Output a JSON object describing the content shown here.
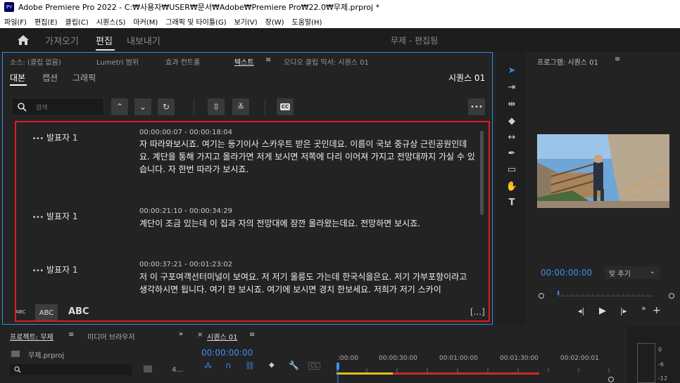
{
  "titlebar": {
    "app_icon": "Pr",
    "title": "Adobe Premiere Pro 2022 - C:₩사용자₩USER₩문서₩Adobe₩Premiere Pro₩22.0₩무제.prproj *"
  },
  "menu": [
    "파일(F)",
    "편집(E)",
    "클립(C)",
    "시퀀스(S)",
    "마커(M)",
    "그래픽 및 타이틀(G)",
    "보기(V)",
    "창(W)",
    "도움말(H)"
  ],
  "workspaces": {
    "import": "가져오기",
    "edit": "편집",
    "export": "내보내기",
    "project_title": "무제 - 편집됨"
  },
  "source_panel": {
    "tabs": [
      "소스: (클립 없음)",
      "Lumetri 범위",
      "효과 컨트롤",
      "텍스트",
      "오디오 클립 믹서: 시퀀스 01"
    ],
    "subtabs": [
      "대본",
      "캡션",
      "그래픽"
    ],
    "sequence_label": "시퀀스 01",
    "search_placeholder": "검색",
    "cc_label": "CC",
    "more_label": "•••",
    "transcript": [
      {
        "speaker": "발표자 1",
        "timecode": "00:00:00:07 - 00:00:18:04",
        "text": "자 따라와보시죠. 여기는 등기이사 스카우트 받은 곳인데요. 이름이 국보 중규상 근린공원인데요. 계단을 통해 가지고 올라가면 저게 보시면 저쪽에 다리 이어져 가지고 전망대까지 가실 수 있습니다. 자 한번 따라가 보시죠."
      },
      {
        "speaker": "발표자 1",
        "timecode": "00:00:21:10 - 00:00:34:29",
        "text": "계단이 조금 있는데 이 집과 자의 전망대에 잠깐 올라왔는데요. 전망하면 보시죠."
      },
      {
        "speaker": "발표자 1",
        "timecode": "00:00:37:21 - 00:01:23:02",
        "text": "저 이 구포여객선터미널이 보여요. 저 저기 울릉도 가는데 한국식을은요. 저기 가부포항이라고 생각하시면 됩니다. 여기 한 보시죠. 여기에 보시면 경치 한보세요. 저희가 저기 스카이"
      }
    ],
    "font_sizes": [
      "ABC",
      "ABC",
      "ABC"
    ],
    "expand_label": "[...]"
  },
  "program": {
    "title": "프로그램: 시퀀스 01",
    "timecode": "00:00:00:00",
    "fit": "맞 추기"
  },
  "project": {
    "tab": "프로젝트: 무제",
    "media_browser": "미디어 브라우저",
    "file": "무제.prproj",
    "count": "4..."
  },
  "timeline": {
    "tab": "시퀀스 01",
    "timecode": "00:00:00:00",
    "ruler": [
      ":00:00",
      "00:00:30:00",
      "00:01:00:00",
      "00:01:30:00",
      "00:02:00:01"
    ]
  },
  "meter": {
    "labels": [
      "0",
      "-6",
      "-12"
    ]
  },
  "colors": {
    "accent": "#2d8ceb",
    "highlight_box": "#e01a22",
    "timecode": "#3f8ef0"
  }
}
